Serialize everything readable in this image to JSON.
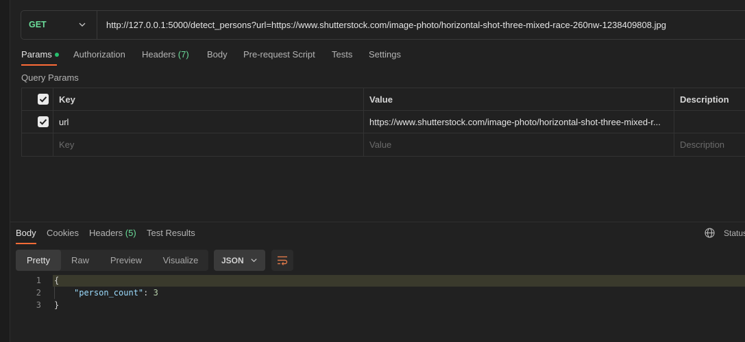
{
  "request": {
    "method": "GET",
    "url": "http://127.0.0.1:5000/detect_persons?url=https://www.shutterstock.com/image-photo/horizontal-shot-three-mixed-race-260nw-1238409808.jpg"
  },
  "request_tabs": [
    {
      "label": "Params"
    },
    {
      "label": "Authorization"
    },
    {
      "label": "Headers",
      "count": "(7)"
    },
    {
      "label": "Body"
    },
    {
      "label": "Pre-request Script"
    },
    {
      "label": "Tests"
    },
    {
      "label": "Settings"
    }
  ],
  "query_params": {
    "title": "Query Params",
    "headers": {
      "key": "Key",
      "value": "Value",
      "description": "Description"
    },
    "rows": [
      {
        "key": "url",
        "value": "https://www.shutterstock.com/image-photo/horizontal-shot-three-mixed-r...",
        "description": ""
      }
    ],
    "placeholder": {
      "key": "Key",
      "value": "Value",
      "description": "Description"
    }
  },
  "response": {
    "tabs": [
      {
        "label": "Body"
      },
      {
        "label": "Cookies"
      },
      {
        "label": "Headers",
        "count": "(5)"
      },
      {
        "label": "Test Results"
      }
    ],
    "status_label": "Status",
    "view_modes": [
      "Pretty",
      "Raw",
      "Preview",
      "Visualize"
    ],
    "format": "JSON",
    "code": {
      "line_numbers": [
        "1",
        "2",
        "3"
      ],
      "open_brace": "{",
      "key": "\"person_count\"",
      "colon": ": ",
      "value": "3",
      "close_brace": "}"
    }
  },
  "colors": {
    "accent": "#ff6c37",
    "method_get": "#6bdd9a",
    "status_dot": "#27c06e"
  }
}
